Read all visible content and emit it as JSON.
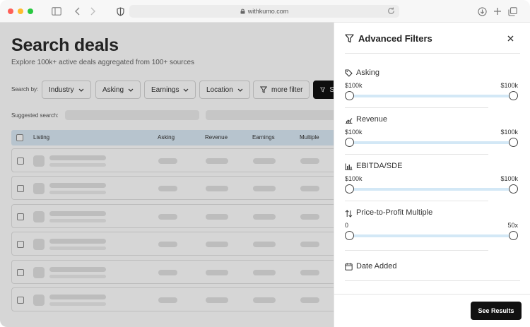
{
  "browser": {
    "url": "withkumo.com",
    "icons": [
      "sidebar-icon",
      "back-icon",
      "forward-icon",
      "shield-icon",
      "lock-icon",
      "reload-icon",
      "download-icon",
      "new-tab-icon",
      "tabs-icon"
    ]
  },
  "page": {
    "title": "Search deals",
    "subtitle": "Explore 100k+ active deals aggregated from 100+ sources",
    "search_by_label": "Search by:",
    "filters": [
      "Industry",
      "Asking",
      "Earnings",
      "Location",
      "more filter"
    ],
    "search_button_label": "S",
    "suggested_label": "Suggested search:",
    "table": {
      "columns": [
        "Listing",
        "Asking",
        "Revenue",
        "Earnings",
        "Multiple"
      ],
      "row_count_visible": 6
    }
  },
  "drawer": {
    "title": "Advanced Filters",
    "sections": [
      {
        "label": "Asking",
        "icon": "tag-icon",
        "min_label": "$100k",
        "max_label": "$100k"
      },
      {
        "label": "Revenue",
        "icon": "bar-chart-icon",
        "min_label": "$100k",
        "max_label": "$100k"
      },
      {
        "label": "EBITDA/SDE",
        "icon": "column-chart-icon",
        "min_label": "$100k",
        "max_label": "$100k"
      },
      {
        "label": "Price-to-Profit Multiple",
        "icon": "sort-arrows-icon",
        "min_label": "0",
        "max_label": "50x"
      }
    ],
    "date_added_label": "Date Added",
    "see_results_label": "See Results"
  },
  "colors": {
    "accent_dark": "#111111",
    "table_header": "#dbeaf6",
    "slider_track": "#d3e8f6",
    "traffic_red": "#fe5f57",
    "traffic_yellow": "#febc2e",
    "traffic_green": "#28c840"
  }
}
